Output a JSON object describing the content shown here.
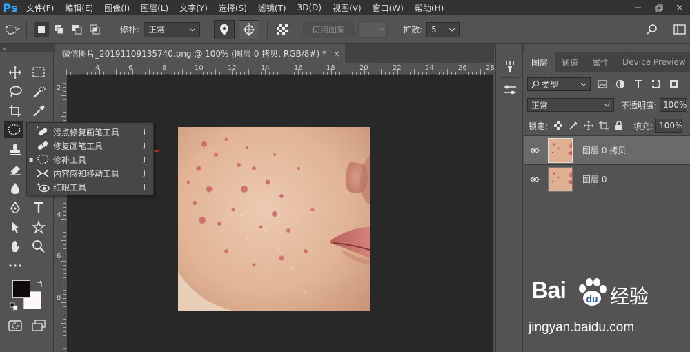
{
  "app": {
    "logo": "Ps"
  },
  "menu": {
    "items": [
      "文件(F)",
      "编辑(E)",
      "图像(I)",
      "图层(L)",
      "文字(Y)",
      "选择(S)",
      "滤镜(T)",
      "3D(D)",
      "视图(V)",
      "窗口(W)",
      "帮助(H)"
    ]
  },
  "options": {
    "patch_label": "修补:",
    "patch_mode": "正常",
    "use_pattern": "使用图案",
    "spread_label": "扩散:",
    "spread_value": "5"
  },
  "document": {
    "tab_title": "微信图片_20191109135740.png @ 100% (图层 0 拷贝, RGB/8#) *",
    "ruler_h": [
      "4",
      "6",
      "8",
      "10",
      "12",
      "14",
      "16",
      "18",
      "20",
      "22",
      "24",
      "26",
      "28"
    ],
    "ruler_v": [
      "2",
      "4",
      "6",
      "8"
    ]
  },
  "flyout": {
    "items": [
      {
        "label": "污点修复画笔工具",
        "key": "J",
        "icon": "spot-healing-brush-icon",
        "selected": false
      },
      {
        "label": "修复画笔工具",
        "key": "J",
        "icon": "healing-brush-icon",
        "selected": false
      },
      {
        "label": "修补工具",
        "key": "J",
        "icon": "patch-tool-icon",
        "selected": true
      },
      {
        "label": "内容感知移动工具",
        "key": "J",
        "icon": "content-aware-move-icon",
        "selected": false
      },
      {
        "label": "红眼工具",
        "key": "J",
        "icon": "red-eye-icon",
        "selected": false
      }
    ],
    "bullet": "▪"
  },
  "colors": {
    "foreground": "#100a0a",
    "background": "#fff8f8",
    "arrow": "#e8232a",
    "accent": "#31a8ff"
  },
  "layers_panel": {
    "tabs": [
      "图层",
      "通道",
      "属性",
      "Device Preview"
    ],
    "kind_filter": "类型",
    "blend_mode": "正常",
    "opacity_label": "不透明度:",
    "opacity": "100%",
    "lock_label": "锁定:",
    "fill_label": "填充:",
    "fill": "100%",
    "layers": [
      {
        "name": "图层 0 拷贝",
        "selected": true
      },
      {
        "name": "图层 0",
        "selected": false
      }
    ]
  },
  "watermark": {
    "brand": "Bai",
    "brand_cn": "经验",
    "url": "jingyan.baidu.com"
  }
}
